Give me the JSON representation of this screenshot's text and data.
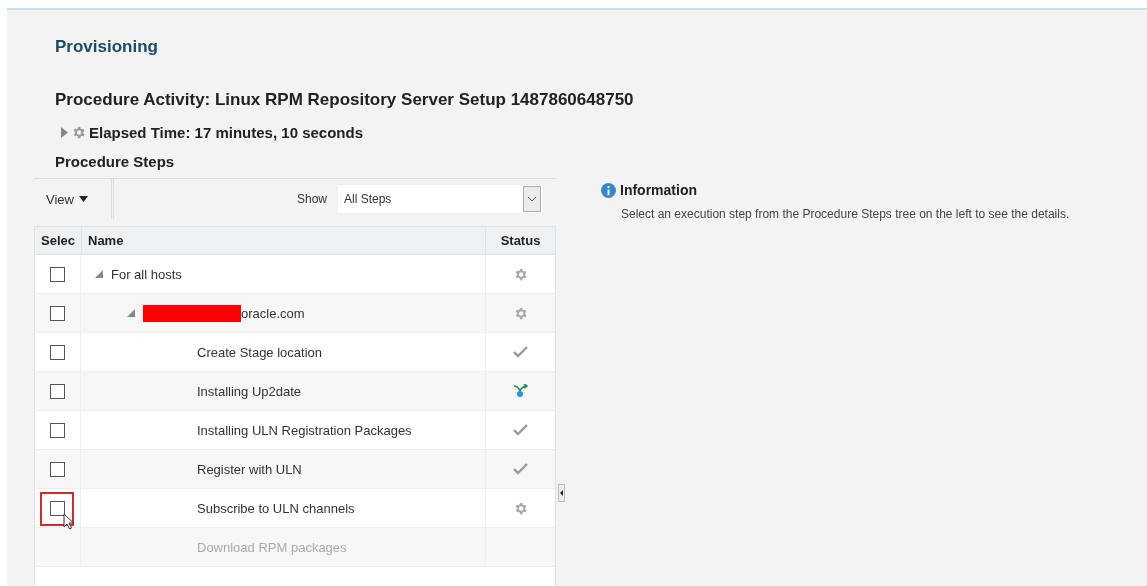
{
  "page_title": "Provisioning",
  "activity_title": "Procedure Activity: Linux RPM Repository Server Setup 1487860648750",
  "elapsed": {
    "label": "Elapsed Time: 17 minutes, 10 seconds",
    "expanded": false
  },
  "steps_panel": {
    "title": "Procedure Steps",
    "view_menu": "View",
    "show_label": "Show",
    "show_value": "All Steps",
    "columns": [
      "Selec",
      "Name",
      "Status"
    ],
    "tree": [
      {
        "name": "For all hosts",
        "kind": "running",
        "checked": false,
        "expanded": true,
        "children": [
          {
            "name": "oracle.com",
            "redacted": true,
            "kind": "running",
            "checked": false,
            "expanded": true,
            "children": [
              {
                "name": "Create Stage location",
                "kind": "done",
                "checked": false,
                "highlighted": false,
                "disabled": false
              },
              {
                "name": "Installing Up2date",
                "kind": "branch",
                "checked": false,
                "highlighted": false,
                "disabled": false
              },
              {
                "name": "Installing ULN Registration Packages",
                "kind": "done",
                "checked": false,
                "highlighted": false,
                "disabled": false
              },
              {
                "name": "Register with ULN",
                "kind": "done",
                "checked": false,
                "highlighted": false,
                "disabled": false
              },
              {
                "name": "Subscribe to ULN channels",
                "kind": "running",
                "checked": false,
                "highlighted": true,
                "disabled": false
              },
              {
                "name": "Download RPM packages",
                "disabled": true
              }
            ]
          }
        ]
      }
    ]
  },
  "info": {
    "title": "Information",
    "text": "Select an execution step from the Procedure Steps tree on the left to see the details."
  }
}
